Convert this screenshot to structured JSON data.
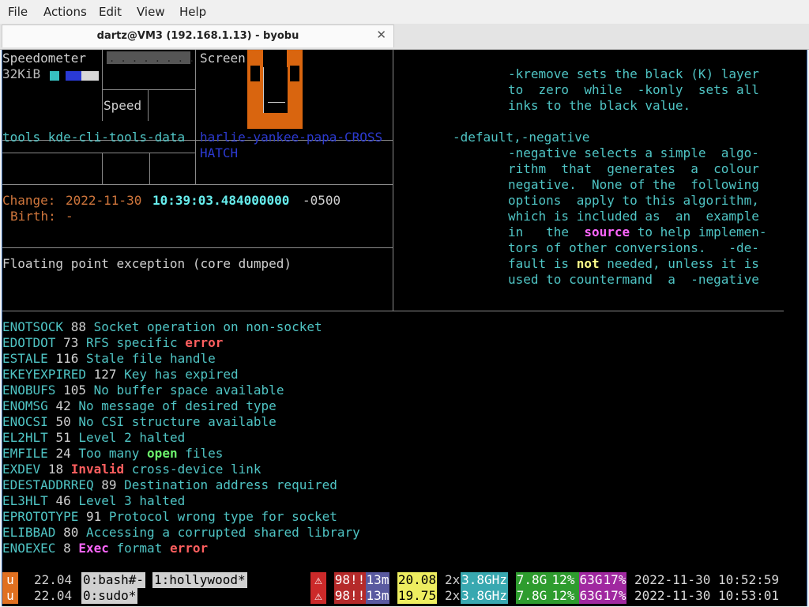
{
  "menu": {
    "file": "File",
    "actions": "Actions",
    "edit": "Edit",
    "view": "View",
    "help": "Help"
  },
  "tab": {
    "title": "dartz@VM3 (192.168.1.13) - byobu",
    "close": "✕"
  },
  "top_left": {
    "speedometer": "Speedometer",
    "dots": ". . . . . . . . .",
    "screen": "Screen",
    "size": "32KiB",
    "speed": "Speed",
    "tools": "tools kde-cli-tools-data",
    "link_line1": "harlie-yankee-papa-CROSS",
    "link_line2": "HATCH"
  },
  "stat": {
    "change_label": "Change:",
    "change_date": "2022-11-30",
    "change_time": "10:39:03.484000000",
    "change_tz": "-0500",
    "birth_label": "Birth:",
    "birth_value": "-"
  },
  "error_msg": "Floating point exception (core dumped)",
  "man": {
    "l1": "-kremove sets the black (K) layer",
    "l2": "to  zero  while  -konly  sets all",
    "l3": "inks to the black value.",
    "l4": "-default,-negative",
    "l5": "-negative selects a simple  algo-",
    "l6": "rithm  that  generates  a  colour",
    "l7": "negative.  None of the  following",
    "l8": "options  apply to this algorithm,",
    "l9": "which is included as  an  example",
    "l10a": "in   the  ",
    "l10b": "source",
    "l10c": " to help implemen-",
    "l11": "tors of other conversions.   -de-",
    "l12a": "fault is ",
    "l12b": "not",
    "l12c": " needed, unless it is",
    "l13": "used to countermand  a  -negative"
  },
  "errno": [
    {
      "name": "ENOTSOCK",
      "num": "88",
      "pre": "Socket operation on non-socket",
      "hl": "",
      "post": ""
    },
    {
      "name": "EDOTDOT",
      "num": "73",
      "pre": "RFS specific ",
      "hl": "error",
      "post": "",
      "hlc": "red"
    },
    {
      "name": "ESTALE",
      "num": "116",
      "pre": "Stale file handle",
      "hl": "",
      "post": ""
    },
    {
      "name": "EKEYEXPIRED",
      "num": "127",
      "pre": "Key has expired",
      "hl": "",
      "post": ""
    },
    {
      "name": "ENOBUFS",
      "num": "105",
      "pre": "No buffer space available",
      "hl": "",
      "post": ""
    },
    {
      "name": "ENOMSG",
      "num": "42",
      "pre": "No message of desired type",
      "hl": "",
      "post": ""
    },
    {
      "name": "ENOCSI",
      "num": "50",
      "pre": "No CSI structure available",
      "hl": "",
      "post": ""
    },
    {
      "name": "EL2HLT",
      "num": "51",
      "pre": "Level 2 halted",
      "hl": "",
      "post": ""
    },
    {
      "name": "EMFILE",
      "num": "24",
      "pre": "Too many ",
      "hl": "open",
      "post": " files",
      "hlc": "grn"
    },
    {
      "name": "EXDEV",
      "num": "18",
      "pre": "",
      "hl": "Invalid",
      "post": " cross-device link",
      "hlc": "red"
    },
    {
      "name": "EDESTADDRREQ",
      "num": "89",
      "pre": "Destination address required",
      "hl": "",
      "post": ""
    },
    {
      "name": "EL3HLT",
      "num": "46",
      "pre": "Level 3 halted",
      "hl": "",
      "post": ""
    },
    {
      "name": "EPROTOTYPE",
      "num": "91",
      "pre": "Protocol wrong type for socket",
      "hl": "",
      "post": ""
    },
    {
      "name": "ELIBBAD",
      "num": "80",
      "pre": "Accessing a corrupted shared library",
      "hl": "",
      "post": ""
    },
    {
      "name": "ENOEXEC",
      "num": "8",
      "pre": "",
      "hl": "Exec",
      "post": " format ",
      "hlc": "mag",
      "tail": "error"
    }
  ],
  "status": [
    {
      "u": "u",
      "ver": "22.04",
      "w0": "0:bash#-",
      "w1": "1:hollywood*",
      "warn": "⚠",
      "load_a": "98!!",
      "uptime": "13m",
      "load": "20.08",
      "cpu_n": "2x",
      "cpu_f": "3.8GHz",
      "mem": "7.8G",
      "mem_p": "12%",
      "disk": "63G",
      "disk_p": "17%",
      "datetime": "2022-11-30 10:52:59"
    },
    {
      "u": "u",
      "ver": "22.04",
      "w0": "0:sudo*",
      "w1": "",
      "warn": "⚠",
      "load_a": "98!!",
      "uptime": "13m",
      "load": "19.75",
      "cpu_n": "2x",
      "cpu_f": "3.8GHz",
      "mem": "7.8G",
      "mem_p": "12%",
      "disk": "63G",
      "disk_p": "17%",
      "datetime": "2022-11-30 10:53:01"
    }
  ],
  "colors": {
    "term_bg": "#000000",
    "cyan": "#4fc4c4",
    "orange": "#d0763c",
    "accent": "#e07020"
  }
}
